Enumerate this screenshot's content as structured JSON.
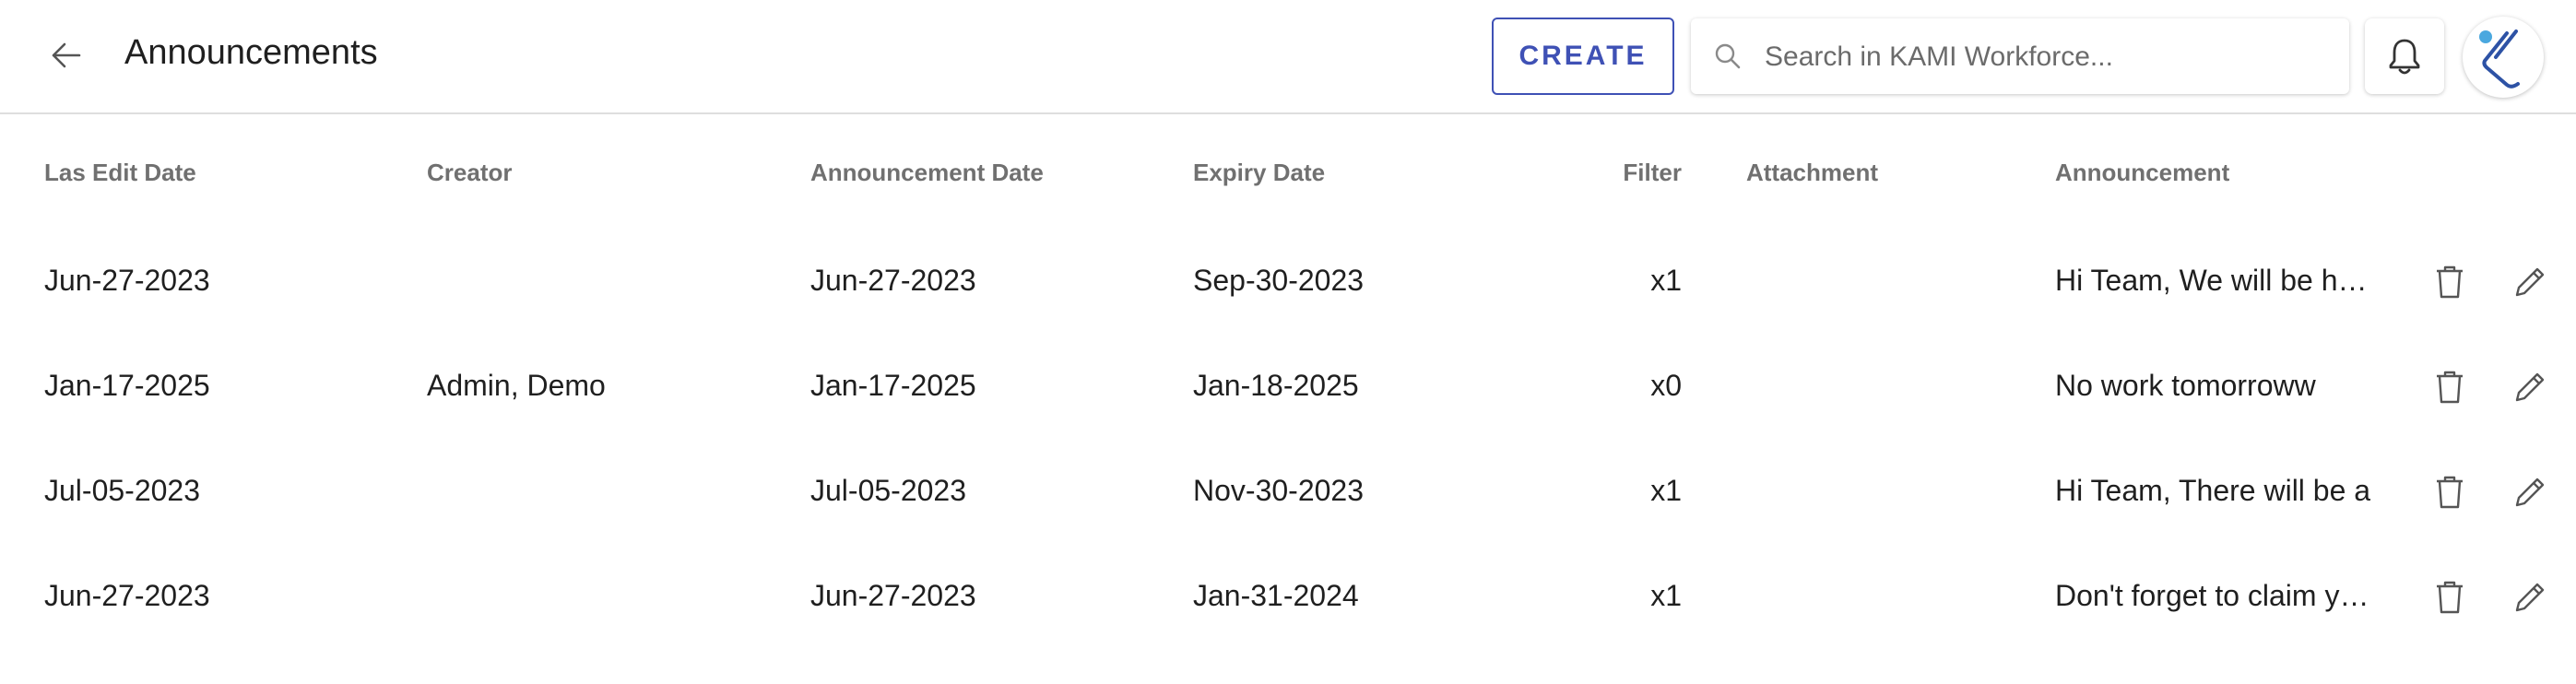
{
  "header": {
    "title": "Announcements",
    "create_label": "CREATE",
    "search_placeholder": "Search in KAMI Workforce..."
  },
  "colors": {
    "accent": "#3f51b5",
    "logo_dot": "#4aa8df",
    "header_text": "#707070"
  },
  "icons": {
    "back": "arrow-left-icon",
    "search": "magnifier-icon",
    "notifications": "bell-icon",
    "delete": "trash-icon",
    "edit": "pencil-icon"
  },
  "table": {
    "columns": [
      "Las Edit Date",
      "Creator",
      "Announcement Date",
      "Expiry Date",
      "Filter",
      "Attachment",
      "Announcement"
    ],
    "rows": [
      {
        "last_edit": "Jun-27-2023",
        "creator": "",
        "announcement_date": "Jun-27-2023",
        "expiry": "Sep-30-2023",
        "filter": "x1",
        "attachment": "",
        "announcement": "Hi Team, We will be having"
      },
      {
        "last_edit": "Jan-17-2025",
        "creator": "Admin, Demo",
        "announcement_date": "Jan-17-2025",
        "expiry": "Jan-18-2025",
        "filter": "x0",
        "attachment": "",
        "announcement": "No work tomorroww"
      },
      {
        "last_edit": "Jul-05-2023",
        "creator": "",
        "announcement_date": "Jul-05-2023",
        "expiry": "Nov-30-2023",
        "filter": "x1",
        "attachment": "",
        "announcement": "Hi Team, There will be a"
      },
      {
        "last_edit": "Jun-27-2023",
        "creator": "",
        "announcement_date": "Jun-27-2023",
        "expiry": "Jan-31-2024",
        "filter": "x1",
        "attachment": "",
        "announcement": "Don't forget to claim your"
      }
    ]
  }
}
